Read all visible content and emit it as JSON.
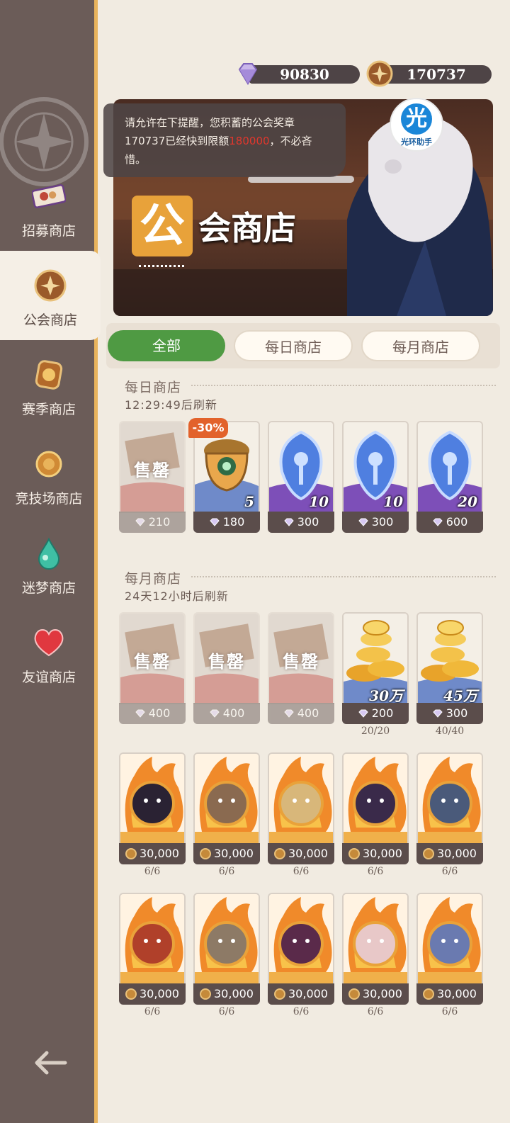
{
  "sidebar": {
    "items": [
      {
        "label": "招募商店",
        "icon": "ticket-icon"
      },
      {
        "label": "公会商店",
        "icon": "guild-badge-icon"
      },
      {
        "label": "赛季商店",
        "icon": "season-coin-icon"
      },
      {
        "label": "竞技场商店",
        "icon": "arena-medal-icon"
      },
      {
        "label": "迷梦商店",
        "icon": "dream-drop-icon"
      },
      {
        "label": "友谊商店",
        "icon": "heart-icon"
      }
    ],
    "active_index": 1
  },
  "currency": {
    "diamonds": "90830",
    "guild_medals": "170737"
  },
  "tooltip": {
    "part1": "请允许在下提醒，您积蓄的公会奖章",
    "part2": "170737已经快到限额",
    "limit": "180000",
    "part3": "，不必吝",
    "part4": "惜。"
  },
  "banner": {
    "title_big": "公",
    "title_rest": "会商店",
    "badge_char": "光",
    "badge_text": "光环助手"
  },
  "tabs": [
    {
      "label": "全部",
      "active": true
    },
    {
      "label": "每日商店",
      "active": false
    },
    {
      "label": "每月商店",
      "active": false
    }
  ],
  "daily": {
    "title": "每日商店",
    "refresh": "12:29:49后刷新",
    "discount": "-30%",
    "items": [
      {
        "sold": true,
        "sold_label": "售罄",
        "price": "210",
        "qty": ""
      },
      {
        "sold": false,
        "price": "180",
        "qty": "5"
      },
      {
        "sold": false,
        "price": "300",
        "qty": "10"
      },
      {
        "sold": false,
        "price": "300",
        "qty": "10"
      },
      {
        "sold": false,
        "price": "600",
        "qty": "20"
      }
    ]
  },
  "monthly": {
    "title": "每月商店",
    "refresh": "24天12小时后刷新",
    "items": [
      {
        "sold": true,
        "sold_label": "售罄",
        "price": "400",
        "qty": "",
        "limit": ""
      },
      {
        "sold": true,
        "sold_label": "售罄",
        "price": "400",
        "qty": "",
        "limit": ""
      },
      {
        "sold": true,
        "sold_label": "售罄",
        "price": "400",
        "qty": "",
        "limit": ""
      },
      {
        "sold": false,
        "price": "200",
        "qty": "30万",
        "limit": "20/20"
      },
      {
        "sold": false,
        "price": "300",
        "qty": "45万",
        "limit": "40/40"
      }
    ],
    "heroes_row1": [
      {
        "price": "30,000",
        "limit": "6/6",
        "tint": "#2a2233"
      },
      {
        "price": "30,000",
        "limit": "6/6",
        "tint": "#8a6a50"
      },
      {
        "price": "30,000",
        "limit": "6/6",
        "tint": "#d8b77a"
      },
      {
        "price": "30,000",
        "limit": "6/6",
        "tint": "#3a2a4a"
      },
      {
        "price": "30,000",
        "limit": "6/6",
        "tint": "#4a5a7a"
      }
    ],
    "heroes_row2": [
      {
        "price": "30,000",
        "limit": "6/6",
        "tint": "#b0402a"
      },
      {
        "price": "30,000",
        "limit": "6/6",
        "tint": "#8d7a66"
      },
      {
        "price": "30,000",
        "limit": "6/6",
        "tint": "#5a2a4a"
      },
      {
        "price": "30,000",
        "limit": "6/6",
        "tint": "#e8c8c8"
      },
      {
        "price": "30,000",
        "limit": "6/6",
        "tint": "#6a7ab0"
      }
    ]
  },
  "colors": {
    "accent_green": "#4f9a43",
    "sidebar_bg": "#6b5c58",
    "gold_border": "#e8b35c"
  }
}
